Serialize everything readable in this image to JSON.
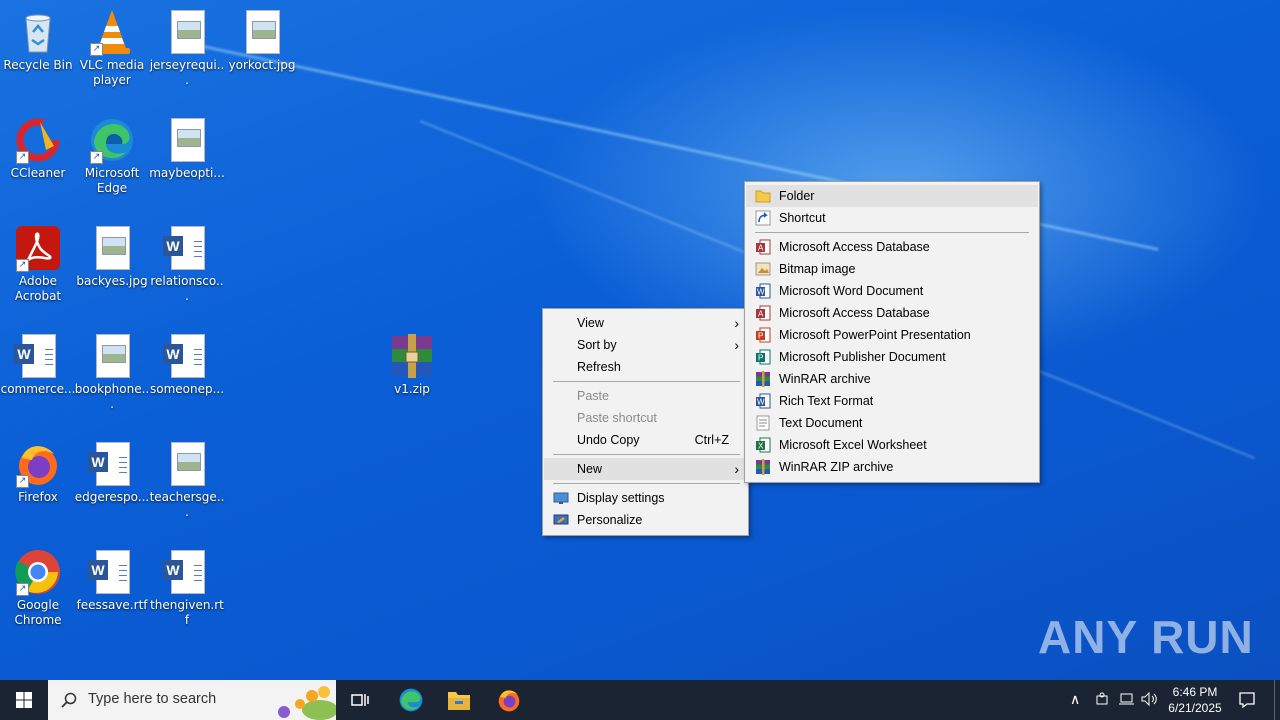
{
  "desktop": {
    "icons": [
      {
        "label": "Recycle Bin"
      },
      {
        "label": "VLC media player"
      },
      {
        "label": "jerseyrequi..."
      },
      {
        "label": "yorkoct.jpg"
      },
      {
        "label": "CCleaner"
      },
      {
        "label": "Microsoft Edge"
      },
      {
        "label": "maybeopti..."
      },
      {
        "label": "Adobe Acrobat"
      },
      {
        "label": "backyes.jpg"
      },
      {
        "label": "relationsco..."
      },
      {
        "label": "commerce..."
      },
      {
        "label": "bookphone..."
      },
      {
        "label": "someonep..."
      },
      {
        "label": "v1.zip"
      },
      {
        "label": "Firefox"
      },
      {
        "label": "edgerespo..."
      },
      {
        "label": "teachersge..."
      },
      {
        "label": "Google Chrome"
      },
      {
        "label": "feessave.rtf"
      },
      {
        "label": "thengiven.rtf"
      }
    ]
  },
  "context_menu": {
    "items": [
      {
        "label": "View"
      },
      {
        "label": "Sort by"
      },
      {
        "label": "Refresh"
      },
      {
        "label": "Paste"
      },
      {
        "label": "Paste shortcut"
      },
      {
        "label": "Undo Copy",
        "shortcut": "Ctrl+Z"
      },
      {
        "label": "New"
      },
      {
        "label": "Display settings"
      },
      {
        "label": "Personalize"
      }
    ]
  },
  "new_submenu": {
    "items": [
      {
        "label": "Folder",
        "icon": "folder-icon"
      },
      {
        "label": "Shortcut",
        "icon": "shortcut-icon"
      },
      {
        "label": "Microsoft Access Database",
        "icon": "access-icon"
      },
      {
        "label": "Bitmap image",
        "icon": "bitmap-icon"
      },
      {
        "label": "Microsoft Word Document",
        "icon": "word-icon"
      },
      {
        "label": "Microsoft Access Database",
        "icon": "access-icon"
      },
      {
        "label": "Microsoft PowerPoint Presentation",
        "icon": "powerpoint-icon"
      },
      {
        "label": "Microsoft Publisher Document",
        "icon": "publisher-icon"
      },
      {
        "label": "WinRAR archive",
        "icon": "winrar-icon"
      },
      {
        "label": "Rich Text Format",
        "icon": "rtf-icon"
      },
      {
        "label": "Text Document",
        "icon": "text-icon"
      },
      {
        "label": "Microsoft Excel Worksheet",
        "icon": "excel-icon"
      },
      {
        "label": "WinRAR ZIP archive",
        "icon": "winrar-zip-icon"
      }
    ]
  },
  "taskbar": {
    "search_placeholder": "Type here to search",
    "time": "6:46 PM",
    "date": "6/21/2025"
  },
  "watermark": "ANY RUN",
  "colors": {
    "desktop": "#0b5fd6",
    "taskbar": "#1b2433",
    "menu_bg": "#f2f2f2",
    "word_blue": "#2b579a"
  }
}
